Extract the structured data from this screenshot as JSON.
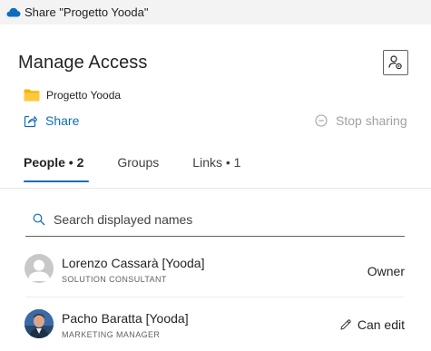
{
  "window": {
    "title": "Share \"Progetto Yooda\""
  },
  "header": {
    "title": "Manage Access"
  },
  "folder": {
    "name": "Progetto Yooda",
    "icon": "folder-icon"
  },
  "actions": {
    "share_label": "Share",
    "stop_sharing_label": "Stop sharing"
  },
  "tabs": [
    {
      "label": "People • 2"
    },
    {
      "label": "Groups"
    },
    {
      "label": "Links • 1"
    }
  ],
  "search": {
    "placeholder": "Search displayed names",
    "value": ""
  },
  "people": [
    {
      "name": "Lorenzo Cassarà [Yooda]",
      "role": "SOLUTION CONSULTANT",
      "permission": "Owner",
      "avatar": "default-avatar-icon"
    },
    {
      "name": "Pacho Baratta [Yooda]",
      "role": "MARKETING MANAGER",
      "permission": "Can edit",
      "avatar": "photo-avatar"
    }
  ],
  "colors": {
    "accent": "#0f6cbd",
    "folder": "#f4b400",
    "disabled": "#a1a1a1"
  }
}
